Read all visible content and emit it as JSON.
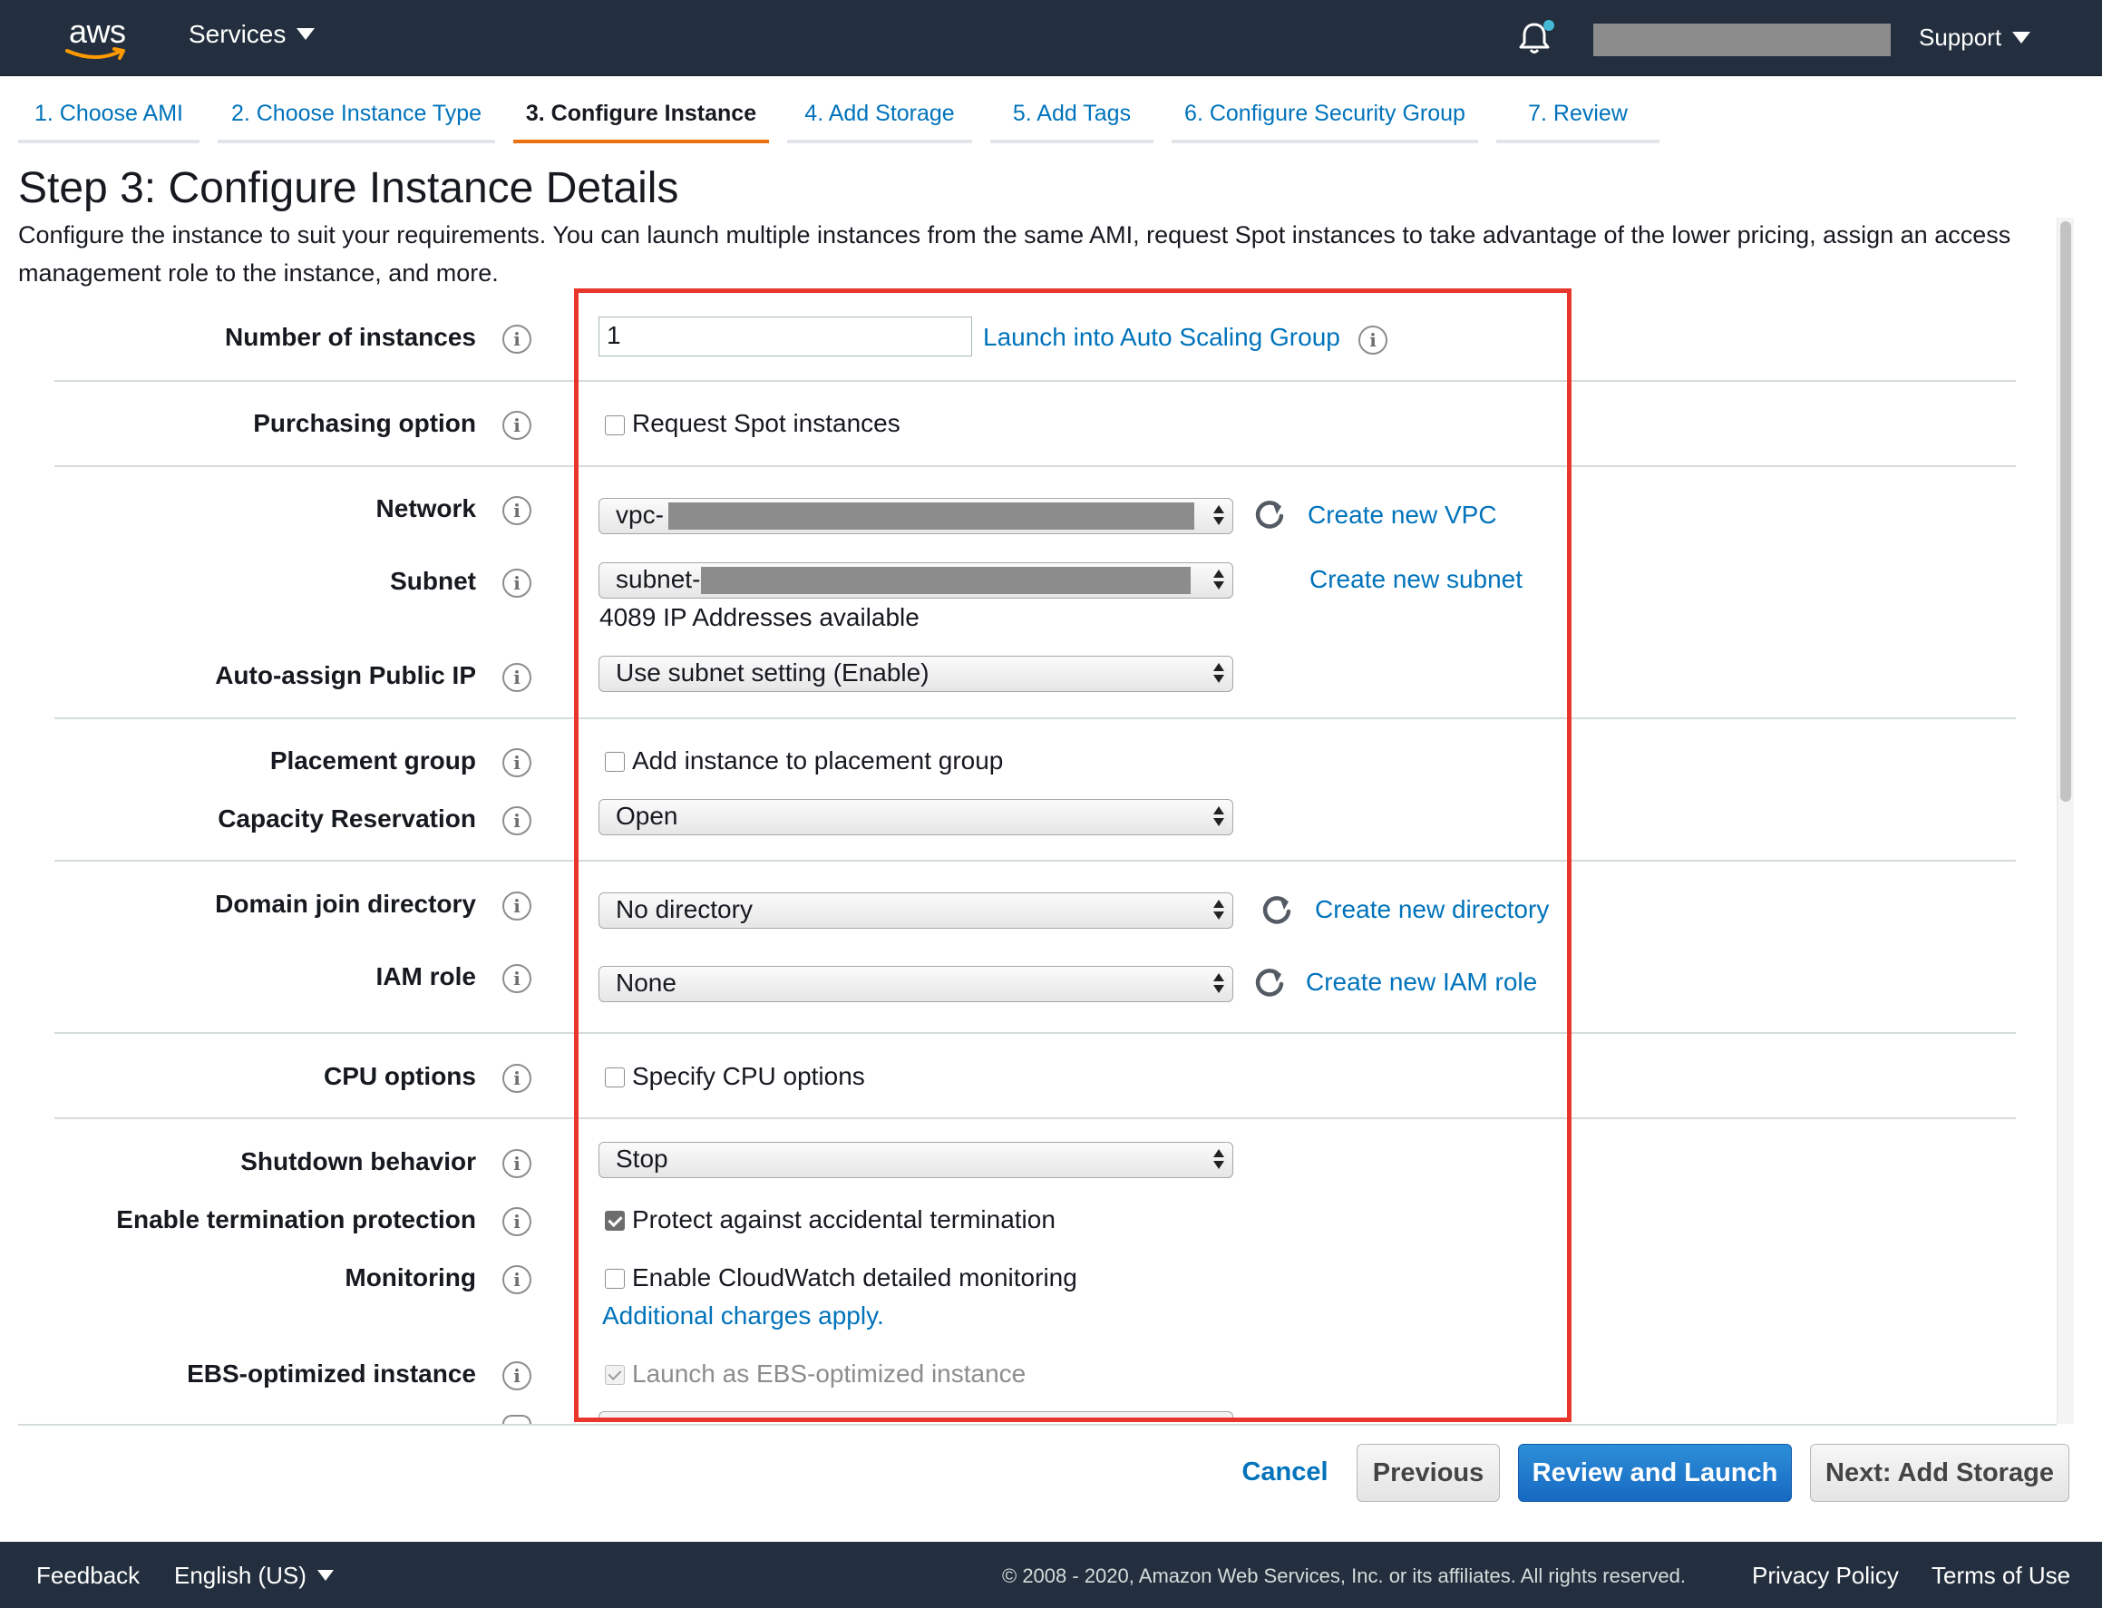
{
  "nav": {
    "logo_text": "aws",
    "services_label": "Services",
    "support_label": "Support"
  },
  "steps": [
    {
      "label": "1. Choose AMI"
    },
    {
      "label": "2. Choose Instance Type"
    },
    {
      "label": "3. Configure Instance",
      "active": true
    },
    {
      "label": "4. Add Storage"
    },
    {
      "label": "5. Add Tags"
    },
    {
      "label": "6. Configure Security Group"
    },
    {
      "label": "7. Review"
    }
  ],
  "page": {
    "title": "Step 3: Configure Instance Details",
    "description": "Configure the instance to suit your requirements. You can launch multiple instances from the same AMI, request Spot instances to take advantage of the lower pricing, assign an access management role to the instance, and more."
  },
  "form": {
    "number_of_instances": {
      "label": "Number of instances",
      "value": "1",
      "link": "Launch into Auto Scaling Group"
    },
    "purchasing_option": {
      "label": "Purchasing option",
      "checkbox_label": "Request Spot instances",
      "checked": false
    },
    "network": {
      "label": "Network",
      "value": "vpc-",
      "link": "Create new VPC"
    },
    "subnet": {
      "label": "Subnet",
      "value": "subnet-",
      "link": "Create new subnet",
      "note": "4089 IP Addresses available"
    },
    "auto_assign_ip": {
      "label": "Auto-assign Public IP",
      "value": "Use subnet setting (Enable)"
    },
    "placement_group": {
      "label": "Placement group",
      "checkbox_label": "Add instance to placement group",
      "checked": false
    },
    "capacity_reservation": {
      "label": "Capacity Reservation",
      "value": "Open"
    },
    "domain_join": {
      "label": "Domain join directory",
      "value": "No directory",
      "link": "Create new directory"
    },
    "iam_role": {
      "label": "IAM role",
      "value": "None",
      "link": "Create new IAM role"
    },
    "cpu_options": {
      "label": "CPU options",
      "checkbox_label": "Specify CPU options",
      "checked": false
    },
    "shutdown_behavior": {
      "label": "Shutdown behavior",
      "value": "Stop"
    },
    "termination_protection": {
      "label": "Enable termination protection",
      "checkbox_label": "Protect against accidental termination",
      "checked": true
    },
    "monitoring": {
      "label": "Monitoring",
      "checkbox_label": "Enable CloudWatch detailed monitoring",
      "checked": false,
      "link": "Additional charges apply."
    },
    "ebs_optimized": {
      "label": "EBS-optimized instance",
      "checkbox_label": "Launch as EBS-optimized instance",
      "checked": true,
      "disabled": true
    }
  },
  "actions": {
    "cancel": "Cancel",
    "previous": "Previous",
    "review_launch": "Review and Launch",
    "next": "Next: Add Storage"
  },
  "footer": {
    "feedback": "Feedback",
    "language": "English (US)",
    "copyright": "© 2008 - 2020, Amazon Web Services, Inc. or its affiliates. All rights reserved.",
    "privacy": "Privacy Policy",
    "terms": "Terms of Use"
  },
  "colors": {
    "nav_bg": "#232f3e",
    "link": "#0073bb",
    "active_tab": "#ec7211",
    "primary_button": "#1769c2",
    "highlight_box": "#e8362c"
  },
  "icons": {
    "bell": "notification-bell-icon",
    "info": "info-icon",
    "refresh": "refresh-icon"
  }
}
